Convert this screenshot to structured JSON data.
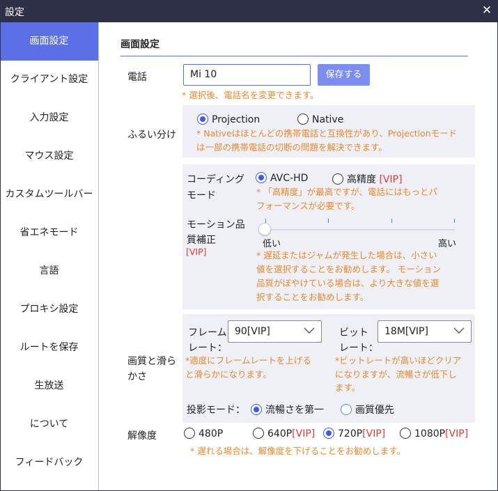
{
  "window": {
    "title": "設定",
    "close_symbol": "✕"
  },
  "sidebar": {
    "items": [
      {
        "label": "画面設定",
        "active": true
      },
      {
        "label": "クライアント設定"
      },
      {
        "label": "入力設定"
      },
      {
        "label": "マウス設定"
      },
      {
        "label": "カスタムツールバー"
      },
      {
        "label": "省エネモード"
      },
      {
        "label": "言語"
      },
      {
        "label": "プロキシ設定"
      },
      {
        "label": "ルートを保存"
      },
      {
        "label": "生放送"
      },
      {
        "label": "について"
      },
      {
        "label": "フィードバック"
      }
    ]
  },
  "main": {
    "heading": "画面設定",
    "phone": {
      "label": "電話",
      "value": "Mi 10",
      "save_label": "保存する",
      "hint": "* 選択後、電話名を変更できます。"
    },
    "split": {
      "label": "ふるい分け",
      "options": [
        {
          "label": "Projection",
          "checked": true
        },
        {
          "label": "Native",
          "checked": false
        }
      ],
      "hint_line1": "* Nativeはほとんどの携帯電話と互換性があり、Projectionモード",
      "hint_line2": "は一部の携帯電話の切断の問題を解決できます。"
    },
    "coding": {
      "label_line1": "コーディング",
      "label_line2": "モード",
      "option1": "AVC-HD",
      "option2": "高精度",
      "option2_vip": "[VIP]",
      "selected": "AVC-HD",
      "hint_line1": "* 「高精度」が最高ですが、電話にはもっとパ",
      "hint_line2": "フォーマンスが必要です。"
    },
    "motion": {
      "label_line1": "モーション品",
      "label_line2": "質補正",
      "label_vip": "[VIP]",
      "low": "低い",
      "high": "高い",
      "level": 0,
      "hint_line1": "* 遅延またはジャムが発生した場合は、小さい",
      "hint_line2": "値を選択することをお勧めします。 モーション",
      "hint_line3": "品質がぼやけている場合は、より大きな値を選",
      "hint_line4": "択することをお勧めします。"
    },
    "quality": {
      "label_line1": "画質と滑ら",
      "label_line2": "かさ",
      "framerate_line1": "フレーム",
      "framerate_line2": "レート：",
      "framerate_value": "90[VIP]",
      "bitrate_line1": "ビット",
      "bitrate_line2": "レート：",
      "bitrate_value": "18M[VIP]",
      "framerate_hint_line1": "*適度にフレームレートを上げる",
      "framerate_hint_line2": "と滑らかになります。",
      "bitrate_hint_line1": "*ビットレートが高いほどクリア",
      "bitrate_hint_line2": "になりますが、流暢さが低下し",
      "bitrate_hint_line3": "ます。",
      "projection_mode_label": "投影モード：",
      "mode_option1": "流暢さを第一",
      "mode_option2": "画質優先",
      "mode_selected": "流暢さを第一"
    },
    "resolution": {
      "label": "解像度",
      "options": [
        {
          "label": "480P",
          "vip": ""
        },
        {
          "label": "640P",
          "vip": "[VIP]"
        },
        {
          "label": "720P",
          "vip": "[VIP]"
        },
        {
          "label": "1080P",
          "vip": "[VIP]"
        }
      ],
      "selected": "720P",
      "hint": "* 遅れる場合は、解像度を下げることをお勧めします。"
    }
  },
  "colors": {
    "titlebar": "#2e3048",
    "accent": "#5b6fe6",
    "hint": "#e8892e",
    "vip": "#e53935",
    "panel": "#eef0f6"
  }
}
